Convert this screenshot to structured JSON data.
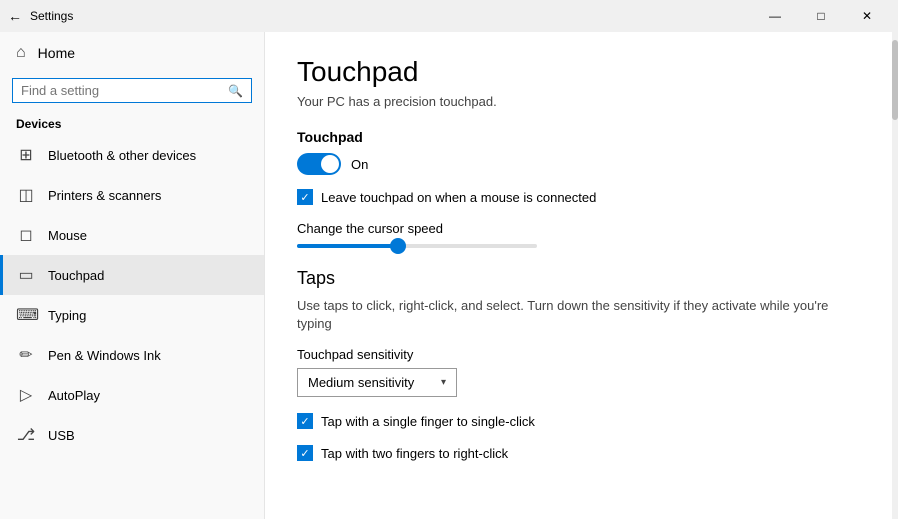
{
  "titleBar": {
    "title": "Settings",
    "minimize": "—",
    "maximize": "□",
    "close": "✕"
  },
  "sidebar": {
    "home": "Home",
    "searchPlaceholder": "Find a setting",
    "devicesLabel": "Devices",
    "items": [
      {
        "id": "bluetooth",
        "label": "Bluetooth & other devices",
        "icon": "⊞"
      },
      {
        "id": "printers",
        "label": "Printers & scanners",
        "icon": "🖨"
      },
      {
        "id": "mouse",
        "label": "Mouse",
        "icon": "🖱"
      },
      {
        "id": "touchpad",
        "label": "Touchpad",
        "icon": "⬜",
        "active": true
      },
      {
        "id": "typing",
        "label": "Typing",
        "icon": "⌨"
      },
      {
        "id": "pen",
        "label": "Pen & Windows Ink",
        "icon": "✏"
      },
      {
        "id": "autoplay",
        "label": "AutoPlay",
        "icon": "▶"
      },
      {
        "id": "usb",
        "label": "USB",
        "icon": "⚓"
      }
    ]
  },
  "main": {
    "title": "Touchpad",
    "subtitle": "Your PC has a precision touchpad.",
    "touchpadSectionLabel": "Touchpad",
    "toggleState": "On",
    "checkboxLabel": "Leave touchpad on when a mouse is connected",
    "sliderLabel": "Change the cursor speed",
    "tapsSectionTitle": "Taps",
    "tapsDescription": "Use taps to click, right-click, and select. Turn down the sensitivity if they activate while you're typing",
    "sensitivityLabel": "Touchpad sensitivity",
    "sensitivityValue": "Medium sensitivity",
    "tap1Label": "Tap with a single finger to single-click",
    "tap2Label": "Tap with two fingers to right-click"
  }
}
